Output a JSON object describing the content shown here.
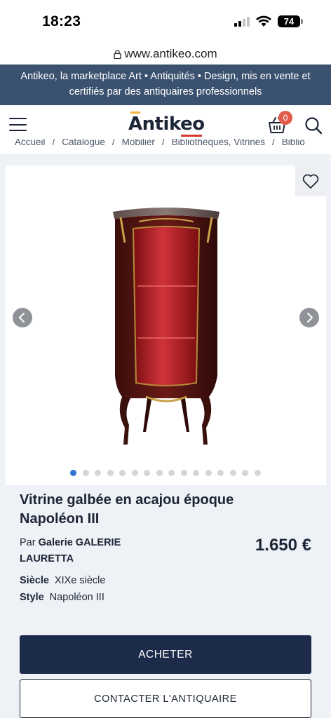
{
  "status_bar": {
    "time": "18:23",
    "battery": "74"
  },
  "browser": {
    "url": "www.antikeo.com"
  },
  "banner": {
    "text": "Antikeo, la marketplace Art • Antiquités • Design, mis en vente et certifiés par des antiquaires professionnels"
  },
  "header": {
    "logo_text": "Antikeo",
    "cart_count": "0",
    "icons": [
      "menu-icon",
      "cart-icon",
      "search-icon"
    ]
  },
  "breadcrumb": [
    "Accueil",
    "Catalogue",
    "Mobilier",
    "Bibliothèques, Vitrines",
    "Biblio"
  ],
  "gallery": {
    "image_count": 16,
    "active_index": 0,
    "icons": [
      "heart-icon",
      "chevron-left-icon",
      "chevron-right-icon"
    ]
  },
  "product": {
    "title": "Vitrine galbée en acajou époque Napoléon III",
    "seller_prefix": "Par",
    "seller_name": "Galerie GALERIE LAURETTA",
    "price": "1.650 €",
    "attributes": [
      {
        "key": "Siècle",
        "value": "XIXe siècle"
      },
      {
        "key": "Style",
        "value": "Napoléon III"
      }
    ]
  },
  "actions": {
    "buy_label": "ACHETER",
    "contact_label": "CONTACTER L'ANTIQUAIRE"
  },
  "colors": {
    "banner_bg": "#3b5170",
    "buy_button_bg": "#1c2b4a",
    "cart_badge": "#e25b4a",
    "active_dot": "#2f74d0",
    "logo_accent_orange": "#f0b33a",
    "logo_accent_red": "#d43a2e"
  }
}
